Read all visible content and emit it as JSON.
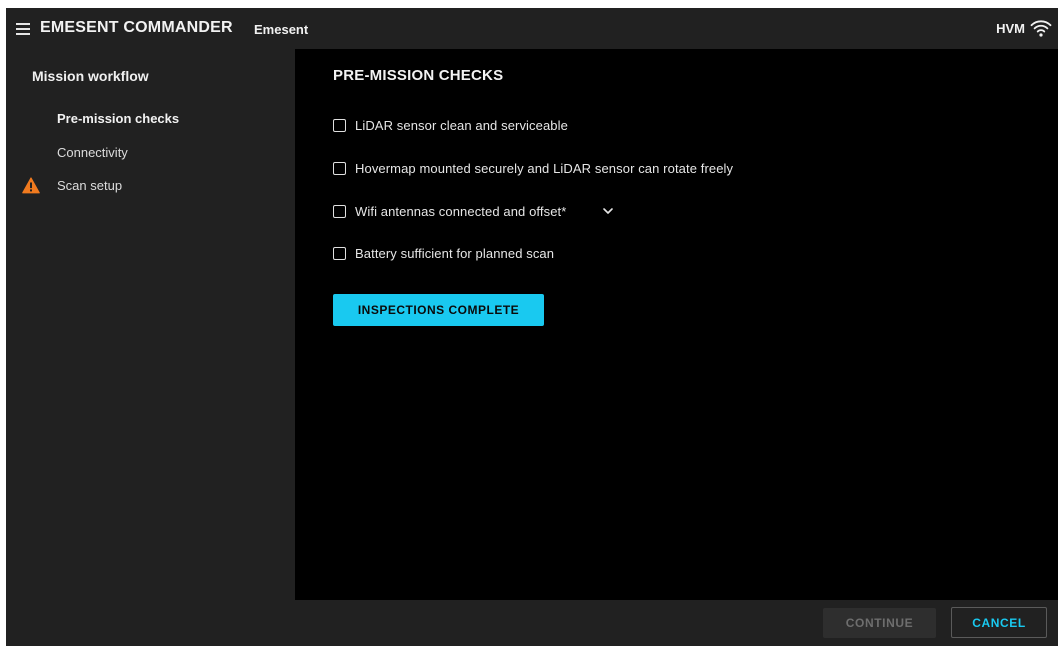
{
  "header": {
    "title": "EMESENT COMMANDER",
    "subtitle": "Emesent",
    "device": "HVM",
    "menu_icon": "hamburger-menu-icon",
    "wifi_icon": "wifi-icon"
  },
  "sidebar": {
    "heading": "Mission workflow",
    "items": [
      {
        "label": "Pre-mission checks",
        "active": true
      },
      {
        "label": "Connectivity",
        "active": false
      },
      {
        "label": "Scan setup",
        "active": false,
        "icon": "warning-icon"
      }
    ]
  },
  "main": {
    "title": "PRE-MISSION CHECKS",
    "checks": [
      {
        "label": "LiDAR sensor clean and serviceable",
        "checked": false
      },
      {
        "label": "Hovermap mounted securely and LiDAR sensor can rotate freely",
        "checked": false
      },
      {
        "label": "Wifi antennas connected and offset*",
        "checked": false,
        "expandable": true
      },
      {
        "label": "Battery sufficient for planned scan",
        "checked": false
      }
    ],
    "complete_button": "INSPECTIONS COMPLETE"
  },
  "footer": {
    "continue_label": "CONTINUE",
    "cancel_label": "CANCEL"
  },
  "colors": {
    "accent": "#19c9f0",
    "warning": "#f07a1f",
    "chrome_background": "#212121",
    "content_background": "#000000"
  }
}
